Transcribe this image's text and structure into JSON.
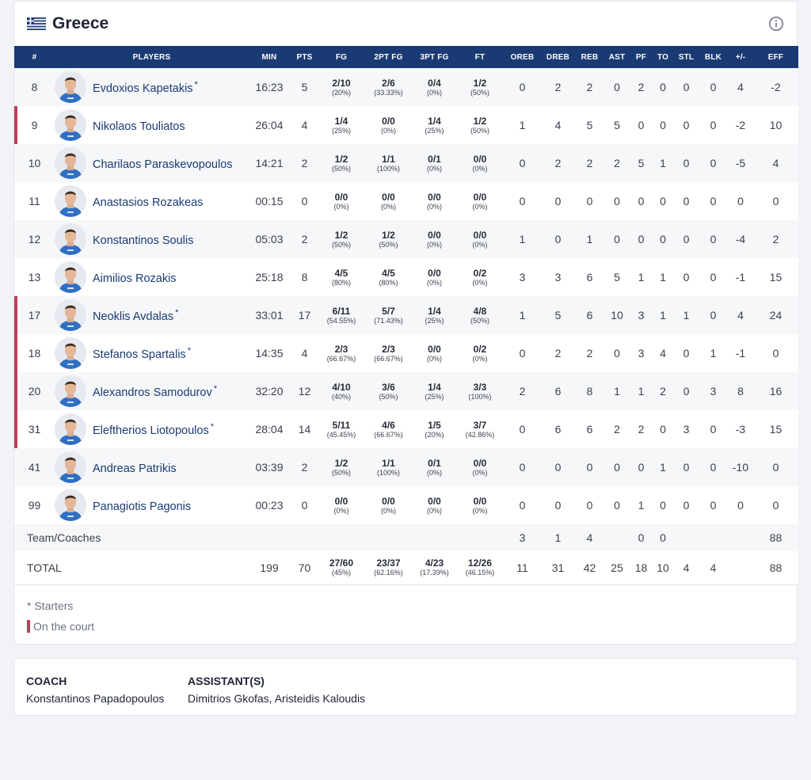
{
  "team": {
    "name": "Greece",
    "flag_icon": "greece-flag-icon",
    "info_icon": "info-icon"
  },
  "table": {
    "headers": [
      "#",
      "PLAYERS",
      "MIN",
      "PTS",
      "FG",
      "2PT FG",
      "3PT FG",
      "FT",
      "OREB",
      "DREB",
      "REB",
      "AST",
      "PF",
      "TO",
      "STL",
      "BLK",
      "+/-",
      "EFF"
    ]
  },
  "players": [
    {
      "num": "8",
      "name": "Evdoxios Kapetakis",
      "starter": "*",
      "on_court": false,
      "min": "16:23",
      "pts": "5",
      "fg": "2/10",
      "fg_pct": "(20%)",
      "fg2": "2/6",
      "fg2_pct": "(33.33%)",
      "fg3": "0/4",
      "fg3_pct": "(0%)",
      "ft": "1/2",
      "ft_pct": "(50%)",
      "oreb": "0",
      "dreb": "2",
      "reb": "2",
      "ast": "0",
      "pf": "2",
      "to": "0",
      "stl": "0",
      "blk": "0",
      "pm": "4",
      "eff": "-2"
    },
    {
      "num": "9",
      "name": "Nikolaos Touliatos",
      "starter": "",
      "on_court": true,
      "min": "26:04",
      "pts": "4",
      "fg": "1/4",
      "fg_pct": "(25%)",
      "fg2": "0/0",
      "fg2_pct": "(0%)",
      "fg3": "1/4",
      "fg3_pct": "(25%)",
      "ft": "1/2",
      "ft_pct": "(50%)",
      "oreb": "1",
      "dreb": "4",
      "reb": "5",
      "ast": "5",
      "pf": "0",
      "to": "0",
      "stl": "0",
      "blk": "0",
      "pm": "-2",
      "eff": "10"
    },
    {
      "num": "10",
      "name": "Charilaos Paraskevopoulos",
      "starter": "",
      "on_court": false,
      "min": "14:21",
      "pts": "2",
      "fg": "1/2",
      "fg_pct": "(50%)",
      "fg2": "1/1",
      "fg2_pct": "(100%)",
      "fg3": "0/1",
      "fg3_pct": "(0%)",
      "ft": "0/0",
      "ft_pct": "(0%)",
      "oreb": "0",
      "dreb": "2",
      "reb": "2",
      "ast": "2",
      "pf": "5",
      "to": "1",
      "stl": "0",
      "blk": "0",
      "pm": "-5",
      "eff": "4"
    },
    {
      "num": "11",
      "name": "Anastasios Rozakeas",
      "starter": "",
      "on_court": false,
      "min": "00:15",
      "pts": "0",
      "fg": "0/0",
      "fg_pct": "(0%)",
      "fg2": "0/0",
      "fg2_pct": "(0%)",
      "fg3": "0/0",
      "fg3_pct": "(0%)",
      "ft": "0/0",
      "ft_pct": "(0%)",
      "oreb": "0",
      "dreb": "0",
      "reb": "0",
      "ast": "0",
      "pf": "0",
      "to": "0",
      "stl": "0",
      "blk": "0",
      "pm": "0",
      "eff": "0"
    },
    {
      "num": "12",
      "name": "Konstantinos Soulis",
      "starter": "",
      "on_court": false,
      "min": "05:03",
      "pts": "2",
      "fg": "1/2",
      "fg_pct": "(50%)",
      "fg2": "1/2",
      "fg2_pct": "(50%)",
      "fg3": "0/0",
      "fg3_pct": "(0%)",
      "ft": "0/0",
      "ft_pct": "(0%)",
      "oreb": "1",
      "dreb": "0",
      "reb": "1",
      "ast": "0",
      "pf": "0",
      "to": "0",
      "stl": "0",
      "blk": "0",
      "pm": "-4",
      "eff": "2"
    },
    {
      "num": "13",
      "name": "Aimilios Rozakis",
      "starter": "",
      "on_court": false,
      "min": "25:18",
      "pts": "8",
      "fg": "4/5",
      "fg_pct": "(80%)",
      "fg2": "4/5",
      "fg2_pct": "(80%)",
      "fg3": "0/0",
      "fg3_pct": "(0%)",
      "ft": "0/2",
      "ft_pct": "(0%)",
      "oreb": "3",
      "dreb": "3",
      "reb": "6",
      "ast": "5",
      "pf": "1",
      "to": "1",
      "stl": "0",
      "blk": "0",
      "pm": "-1",
      "eff": "15"
    },
    {
      "num": "17",
      "name": "Neoklis Avdalas",
      "starter": "*",
      "on_court": true,
      "min": "33:01",
      "pts": "17",
      "fg": "6/11",
      "fg_pct": "(54.55%)",
      "fg2": "5/7",
      "fg2_pct": "(71.43%)",
      "fg3": "1/4",
      "fg3_pct": "(25%)",
      "ft": "4/8",
      "ft_pct": "(50%)",
      "oreb": "1",
      "dreb": "5",
      "reb": "6",
      "ast": "10",
      "pf": "3",
      "to": "1",
      "stl": "1",
      "blk": "0",
      "pm": "4",
      "eff": "24"
    },
    {
      "num": "18",
      "name": "Stefanos Spartalis",
      "starter": "*",
      "on_court": true,
      "min": "14:35",
      "pts": "4",
      "fg": "2/3",
      "fg_pct": "(66.67%)",
      "fg2": "2/3",
      "fg2_pct": "(66.67%)",
      "fg3": "0/0",
      "fg3_pct": "(0%)",
      "ft": "0/2",
      "ft_pct": "(0%)",
      "oreb": "0",
      "dreb": "2",
      "reb": "2",
      "ast": "0",
      "pf": "3",
      "to": "4",
      "stl": "0",
      "blk": "1",
      "pm": "-1",
      "eff": "0"
    },
    {
      "num": "20",
      "name": "Alexandros Samodurov",
      "starter": "*",
      "on_court": true,
      "min": "32:20",
      "pts": "12",
      "fg": "4/10",
      "fg_pct": "(40%)",
      "fg2": "3/6",
      "fg2_pct": "(50%)",
      "fg3": "1/4",
      "fg3_pct": "(25%)",
      "ft": "3/3",
      "ft_pct": "(100%)",
      "oreb": "2",
      "dreb": "6",
      "reb": "8",
      "ast": "1",
      "pf": "1",
      "to": "2",
      "stl": "0",
      "blk": "3",
      "pm": "8",
      "eff": "16"
    },
    {
      "num": "31",
      "name": "Eleftherios Liotopoulos",
      "starter": "*",
      "on_court": true,
      "min": "28:04",
      "pts": "14",
      "fg": "5/11",
      "fg_pct": "(45.45%)",
      "fg2": "4/6",
      "fg2_pct": "(66.67%)",
      "fg3": "1/5",
      "fg3_pct": "(20%)",
      "ft": "3/7",
      "ft_pct": "(42.86%)",
      "oreb": "0",
      "dreb": "6",
      "reb": "6",
      "ast": "2",
      "pf": "2",
      "to": "0",
      "stl": "3",
      "blk": "0",
      "pm": "-3",
      "eff": "15"
    },
    {
      "num": "41",
      "name": "Andreas Patrikis",
      "starter": "",
      "on_court": false,
      "min": "03:39",
      "pts": "2",
      "fg": "1/2",
      "fg_pct": "(50%)",
      "fg2": "1/1",
      "fg2_pct": "(100%)",
      "fg3": "0/1",
      "fg3_pct": "(0%)",
      "ft": "0/0",
      "ft_pct": "(0%)",
      "oreb": "0",
      "dreb": "0",
      "reb": "0",
      "ast": "0",
      "pf": "0",
      "to": "1",
      "stl": "0",
      "blk": "0",
      "pm": "-10",
      "eff": "0"
    },
    {
      "num": "99",
      "name": "Panagiotis Pagonis",
      "starter": "",
      "on_court": false,
      "min": "00:23",
      "pts": "0",
      "fg": "0/0",
      "fg_pct": "(0%)",
      "fg2": "0/0",
      "fg2_pct": "(0%)",
      "fg3": "0/0",
      "fg3_pct": "(0%)",
      "ft": "0/0",
      "ft_pct": "(0%)",
      "oreb": "0",
      "dreb": "0",
      "reb": "0",
      "ast": "0",
      "pf": "1",
      "to": "0",
      "stl": "0",
      "blk": "0",
      "pm": "0",
      "eff": "0"
    }
  ],
  "team_coaches": {
    "label": "Team/Coaches",
    "oreb": "3",
    "dreb": "1",
    "reb": "4",
    "ast": "",
    "pf": "0",
    "to": "0",
    "stl": "",
    "blk": "",
    "pm": "",
    "eff": "88"
  },
  "total": {
    "label": "TOTAL",
    "min": "199",
    "pts": "70",
    "fg": "27/60",
    "fg_pct": "(45%)",
    "fg2": "23/37",
    "fg2_pct": "(62.16%)",
    "fg3": "4/23",
    "fg3_pct": "(17.39%)",
    "ft": "12/26",
    "ft_pct": "(46.15%)",
    "oreb": "11",
    "dreb": "31",
    "reb": "42",
    "ast": "25",
    "pf": "18",
    "to": "10",
    "stl": "4",
    "blk": "4",
    "pm": "",
    "eff": "88"
  },
  "legend": {
    "starters": "* Starters",
    "on_court": "On the court"
  },
  "colors": {
    "header_bg": "#1a3a73",
    "on_court": "#c23b5a",
    "player_link": "#1a3a73"
  },
  "staff": {
    "coach_label": "COACH",
    "coach_name": "Konstantinos Papadopoulos",
    "assistants_label": "ASSISTANT(S)",
    "assistants_names": "Dimitrios Gkofas, Aristeidis Kaloudis"
  }
}
